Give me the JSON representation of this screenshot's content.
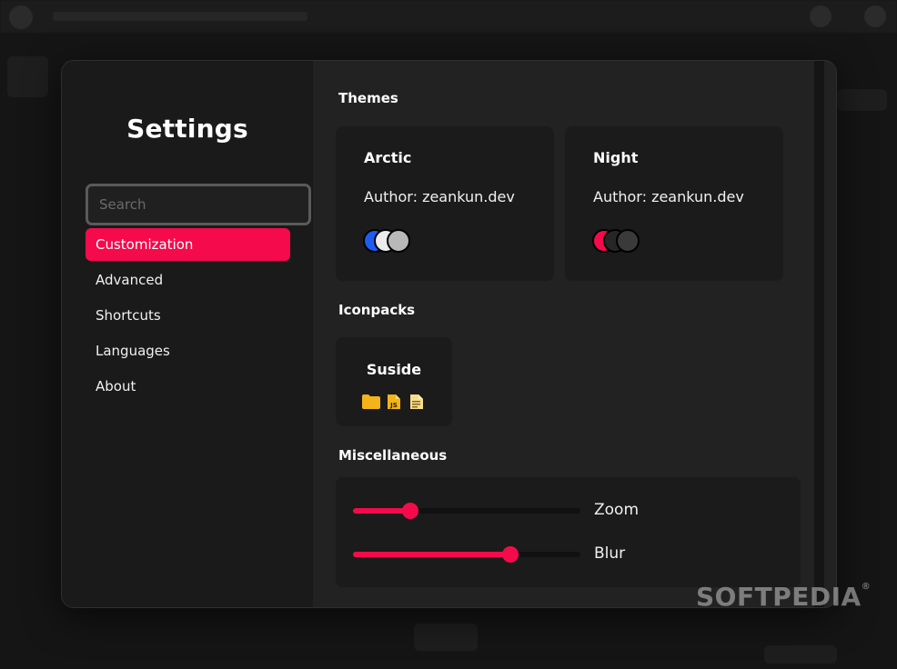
{
  "settings": {
    "title": "Settings",
    "search_placeholder": "Search",
    "nav": [
      {
        "label": "Customization",
        "active": true
      },
      {
        "label": "Advanced",
        "active": false
      },
      {
        "label": "Shortcuts",
        "active": false
      },
      {
        "label": "Languages",
        "active": false
      },
      {
        "label": "About",
        "active": false
      }
    ]
  },
  "themes": {
    "title": "Themes",
    "items": [
      {
        "name": "Arctic",
        "author": "Author: zeankun.dev",
        "swatches": [
          "#1d5cf0",
          "#ececec",
          "#b8b8b8"
        ]
      },
      {
        "name": "Night",
        "author": "Author: zeankun.dev",
        "swatches": [
          "#f50a4b",
          "#262626",
          "#3a3a3a"
        ]
      }
    ]
  },
  "iconpacks": {
    "title": "Iconpacks",
    "items": [
      {
        "name": "Suside",
        "icons": [
          "folder-icon",
          "js-file-icon",
          "text-file-icon"
        ]
      }
    ]
  },
  "misc": {
    "title": "Miscellaneous",
    "zoom": {
      "label": "Zoom",
      "value": 0.25
    },
    "blur": {
      "label": "Blur",
      "value": 0.69
    }
  },
  "colors": {
    "accent": "#f50a4b",
    "panel": "#222222",
    "sidebar": "#1a1a1a",
    "card": "#1b1b1b"
  },
  "watermark": {
    "text": "SOFTPEDIA",
    "mark": "®"
  }
}
